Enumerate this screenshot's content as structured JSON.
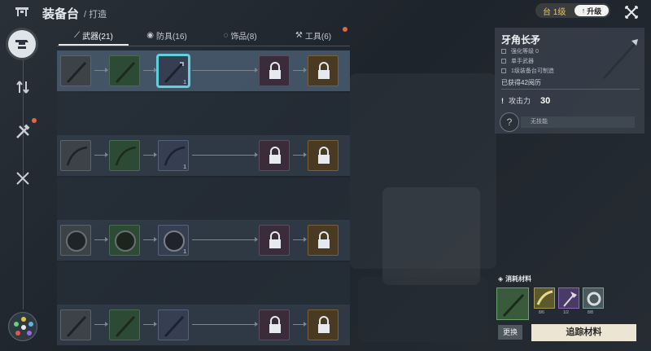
{
  "header": {
    "title": "装备台",
    "breadcrumb": "/ 打造",
    "level_label": "台 1级",
    "upgrade_label": "升级"
  },
  "tabs": [
    {
      "label": "武器(21)",
      "icon": "sword-icon"
    },
    {
      "label": "防具(16)",
      "icon": "armor-icon"
    },
    {
      "label": "饰品(8)",
      "icon": "accessory-icon"
    },
    {
      "label": "工具(6)",
      "icon": "tool-icon"
    }
  ],
  "rows": [
    {
      "type": "spear",
      "nodes": [
        "grey",
        "green",
        "blue",
        "purple-locked",
        "gold-locked"
      ],
      "count_on_third": "1"
    },
    {
      "type": "bow",
      "nodes": [
        "grey",
        "green",
        "blue",
        "purple-locked",
        "gold-locked"
      ],
      "count_on_third": "1"
    },
    {
      "type": "shield",
      "nodes": [
        "grey",
        "green",
        "blue",
        "purple-locked",
        "gold-locked"
      ],
      "count_on_third": "1"
    },
    {
      "type": "sword",
      "nodes": [
        "grey",
        "green",
        "blue",
        "purple-locked",
        "gold-locked"
      ],
      "count_on_third": ""
    }
  ],
  "detail": {
    "name": "牙角长矛",
    "stat1": "强化等级 0",
    "stat2": "单手武器",
    "stat3": "1级装备台可制造",
    "owned": "已获得42阅历",
    "attack_label": "攻击力",
    "attack_value": "30",
    "skill_text": "无技能"
  },
  "materials": {
    "title": "消耗材料",
    "counts": [
      "8/6",
      "1/2",
      "8/8"
    ],
    "swap_label": "更换",
    "track_label": "追踪材料"
  },
  "colors": {
    "accent_selected": "#5fd0de",
    "gold": "#e2c36a",
    "notification": "#e2683e"
  }
}
